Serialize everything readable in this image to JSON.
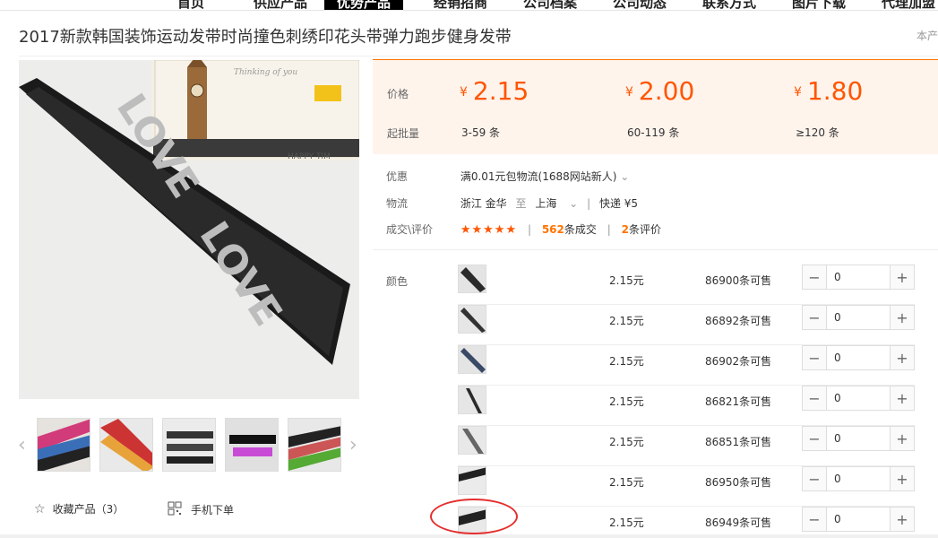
{
  "topnav": [
    "首页",
    "供应产品",
    "优势产品",
    "经销招商",
    "公司档案",
    "公司动态",
    "联系方式",
    "图片下载",
    "代理加盟"
  ],
  "title": "2017新款韩国装饰运动发带时尚撞色刺绣印花头带弹力跑步健身发带",
  "title_right": "本产",
  "price_panel": {
    "price_label": "价格",
    "moq_label": "起批量",
    "currency": "¥",
    "tiers": [
      {
        "price": "2.15",
        "qty": "3-59 条"
      },
      {
        "price": "2.00",
        "qty": "60-119 条"
      },
      {
        "price": "1.80",
        "qty": "≥120 条"
      }
    ]
  },
  "info": {
    "promo_label": "优惠",
    "promo_text": "满0.01元包物流(1688网站新人)",
    "logistics_label": "物流",
    "origin": "浙江 金华",
    "to": "至",
    "dest": "上海",
    "shipping": "快递 ¥5",
    "deal_label": "成交\\评价",
    "stars": "★★★★★",
    "deals_count": "562",
    "deals_text": "条成交",
    "reviews_count": "2",
    "reviews_text": "条评价"
  },
  "color_label": "颜色",
  "skus": [
    {
      "price": "2.15元",
      "stock": "86900条可售",
      "qty": "0"
    },
    {
      "price": "2.15元",
      "stock": "86892条可售",
      "qty": "0"
    },
    {
      "price": "2.15元",
      "stock": "86902条可售",
      "qty": "0"
    },
    {
      "price": "2.15元",
      "stock": "86821条可售",
      "qty": "0"
    },
    {
      "price": "2.15元",
      "stock": "86851条可售",
      "qty": "0"
    },
    {
      "price": "2.15元",
      "stock": "86950条可售",
      "qty": "0"
    },
    {
      "price": "2.15元",
      "stock": "86949条可售",
      "qty": "0"
    }
  ],
  "fav_label": "收藏产品（3）",
  "mobile_label": "手机下单",
  "main_image_text": "LOVE",
  "card_text": {
    "top": "Thinking of you",
    "bottom": "HAPPY TIM"
  },
  "colors": {
    "accent": "#ff5500",
    "price_bg": "#fff4ec",
    "highlight": "#e52e2e"
  }
}
